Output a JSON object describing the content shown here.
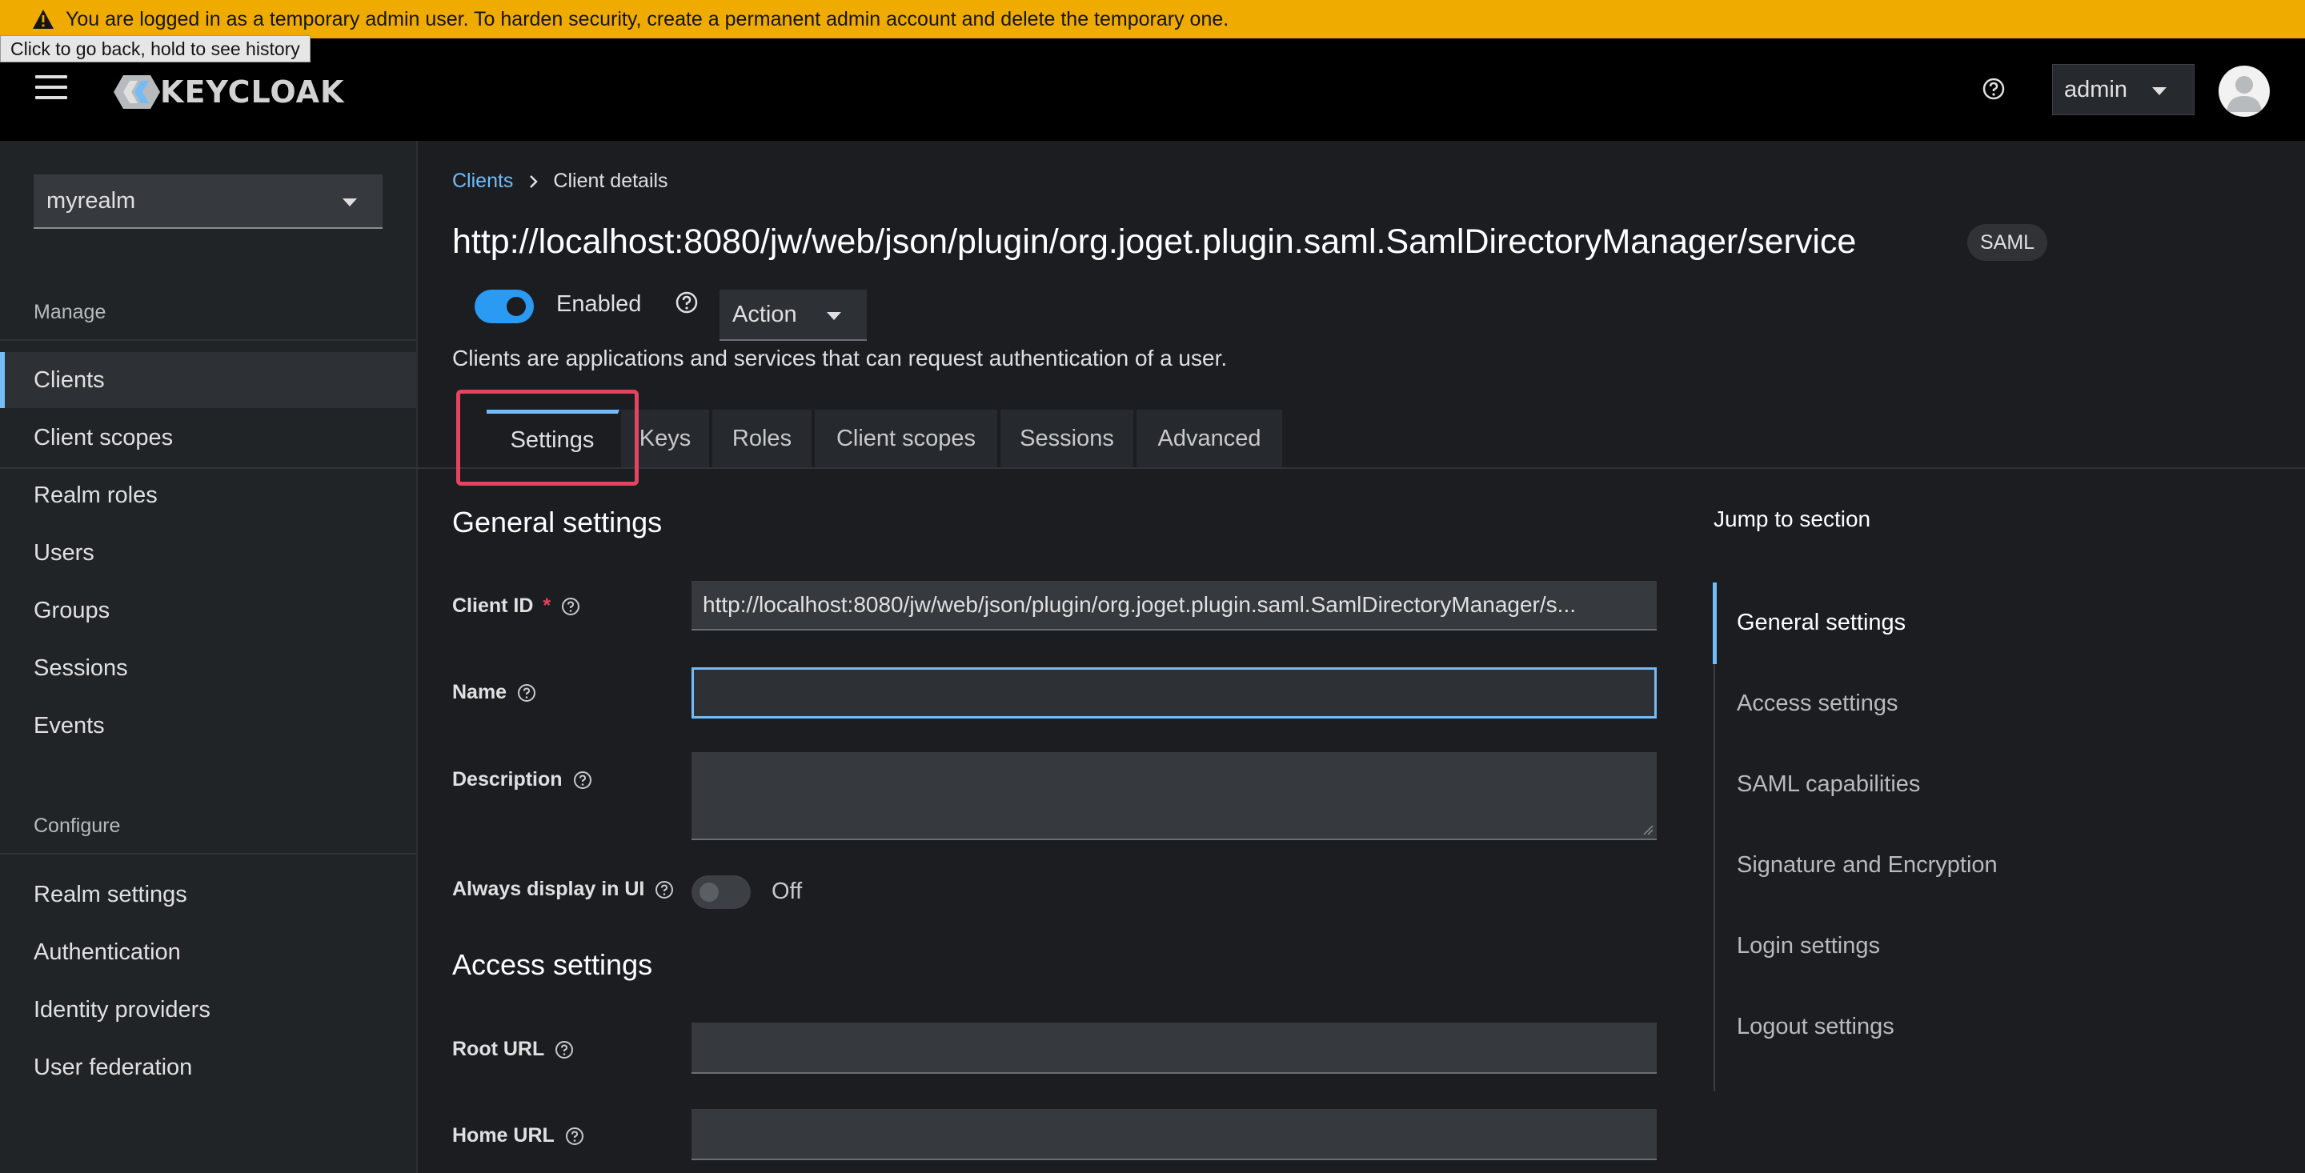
{
  "banner": {
    "text": "You are logged in as a temporary admin user. To harden security, create a permanent admin account and delete the temporary one.",
    "color": "#f0ab00"
  },
  "tooltip": "Click to go back, hold to see history",
  "header": {
    "brand": "KEYCLOAK",
    "user": "admin",
    "icons": [
      "menu-icon",
      "help-icon",
      "avatar-icon"
    ]
  },
  "sidebar": {
    "realm": "myrealm",
    "manage_title": "Manage",
    "manage_items": [
      {
        "label": "Clients",
        "active": true
      },
      {
        "label": "Client scopes"
      },
      {
        "label": "Realm roles"
      },
      {
        "label": "Users"
      },
      {
        "label": "Groups"
      },
      {
        "label": "Sessions"
      },
      {
        "label": "Events"
      }
    ],
    "configure_title": "Configure",
    "configure_items": [
      {
        "label": "Realm settings"
      },
      {
        "label": "Authentication"
      },
      {
        "label": "Identity providers"
      },
      {
        "label": "User federation"
      }
    ]
  },
  "breadcrumb": {
    "link": "Clients",
    "current": "Client details"
  },
  "client": {
    "title": "http://localhost:8080/jw/web/json/plugin/org.joget.plugin.saml.SamlDirectoryManager/service",
    "badge": "SAML",
    "enabled_label": "Enabled",
    "enabled": true,
    "action_label": "Action",
    "description": "Clients are applications and services that can request authentication of a user."
  },
  "tabs": [
    "Settings",
    "Keys",
    "Roles",
    "Client scopes",
    "Sessions",
    "Advanced"
  ],
  "form": {
    "general_title": "General settings",
    "client_id_label": "Client ID",
    "required_mark": "*",
    "client_id_value": "http://localhost:8080/jw/web/json/plugin/org.joget.plugin.saml.SamlDirectoryManager/s...",
    "name_label": "Name",
    "name_value": "",
    "description_label": "Description",
    "always_display_label": "Always display in UI",
    "always_display_state": "Off",
    "access_title": "Access settings",
    "root_url_label": "Root URL",
    "home_url_label": "Home URL"
  },
  "jump": {
    "title": "Jump to section",
    "items": [
      "General settings",
      "Access settings",
      "SAML capabilities",
      "Signature and Encryption",
      "Login settings",
      "Logout settings"
    ]
  },
  "colors": {
    "accent": "#73bcf7",
    "toggle_on": "#2b9af3",
    "highlight": "#e5435f",
    "background": "#1b1d21"
  }
}
